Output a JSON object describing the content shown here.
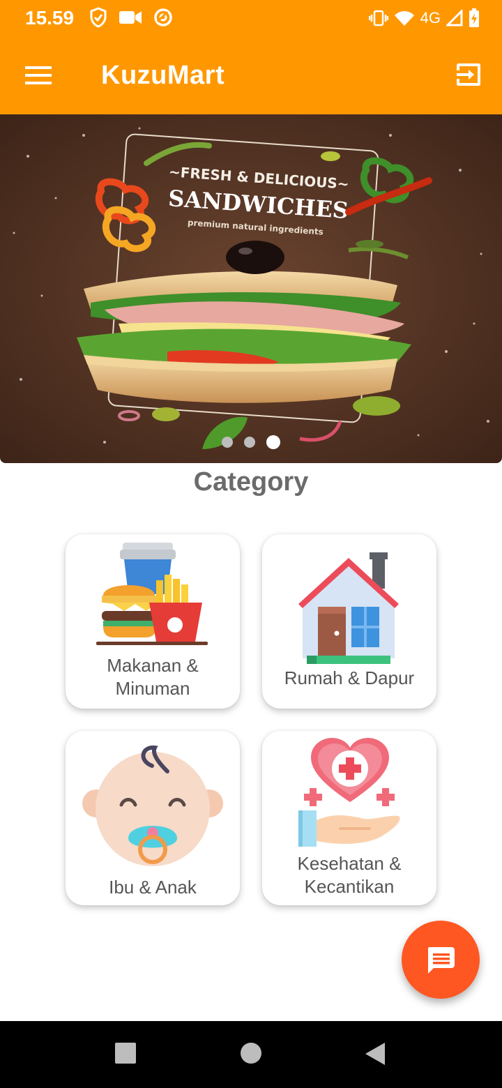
{
  "status_bar": {
    "time": "15.59",
    "network": "4G"
  },
  "app_bar": {
    "title": "KuzuMart",
    "menu_icon": "hamburger-menu-icon",
    "logout_icon": "logout-icon"
  },
  "banner": {
    "line1": "~FRESH & DELICIOUS~",
    "line2": "SANDWICHES",
    "line3": "premium natural ingredients",
    "slide_count": 3,
    "active_slide": 3
  },
  "category": {
    "title": "Category",
    "items": [
      {
        "line1": "Makanan &",
        "line2": "Minuman",
        "icon": "fast-food-icon"
      },
      {
        "line1": "Rumah & Dapur",
        "icon": "house-icon"
      },
      {
        "line1": "Ibu & Anak",
        "icon": "baby-icon"
      },
      {
        "line1": "Kesehatan &",
        "line2": "Kecantikan",
        "icon": "health-care-icon"
      }
    ]
  },
  "fab": {
    "icon": "chat-icon"
  },
  "colors": {
    "primary": "#FF9800",
    "fab": "#FF5722",
    "title_text": "#6b6b6b"
  }
}
